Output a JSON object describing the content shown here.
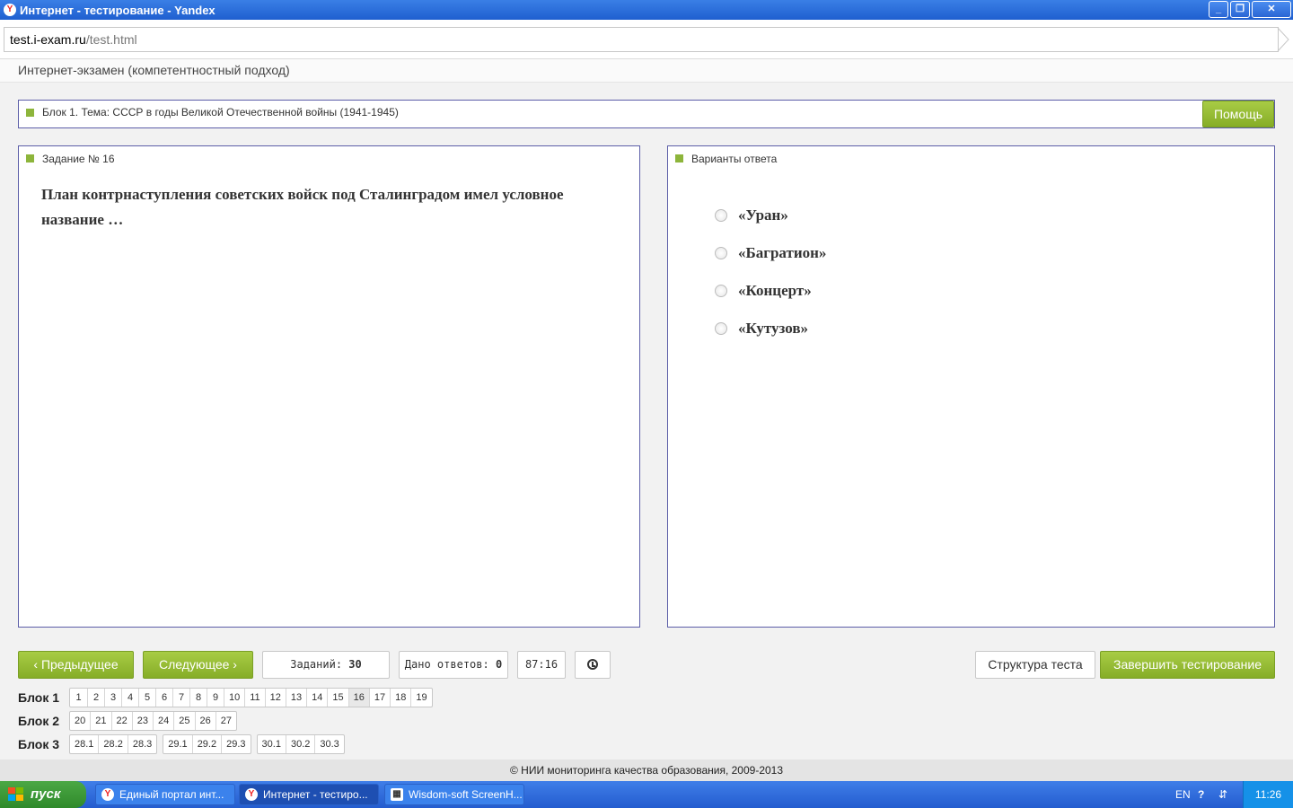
{
  "window": {
    "title": "Интернет - тестирование - Yandex"
  },
  "browser": {
    "url_host": "test.i-exam.ru",
    "url_path": "/test.html"
  },
  "page": {
    "header": "Интернет-экзамен (компетентностный подход)"
  },
  "topic": {
    "title": "Блок 1. Тема: СССР в годы Великой Отечественной войны (1941-1945)",
    "help_label": "Помощь"
  },
  "task": {
    "header": "Задание № 16",
    "question": "План контрнаступления советских войск под Сталинградом имел условное название …"
  },
  "answers": {
    "header": "Варианты ответа",
    "options": [
      "«Уран»",
      "«Багратион»",
      "«Концерт»",
      "«Кутузов»"
    ]
  },
  "controls": {
    "prev_label": "Предыдущее",
    "next_label": "Следующее",
    "tasks_label": "Заданий:",
    "tasks_count": "30",
    "answered_label": "Дано ответов:",
    "answered_count": "0",
    "timer": "87:16",
    "structure_label": "Структура теста",
    "finish_label": "Завершить тестирование"
  },
  "blocks": [
    {
      "label": "Блок 1",
      "groups": [
        [
          "1",
          "2",
          "3",
          "4",
          "5",
          "6",
          "7",
          "8",
          "9",
          "10",
          "11",
          "12",
          "13",
          "14",
          "15",
          "16",
          "17",
          "18",
          "19"
        ]
      ]
    },
    {
      "label": "Блок 2",
      "groups": [
        [
          "20",
          "21",
          "22",
          "23",
          "24",
          "25",
          "26",
          "27"
        ]
      ]
    },
    {
      "label": "Блок 3",
      "groups": [
        [
          "28.1",
          "28.2",
          "28.3"
        ],
        [
          "29.1",
          "29.2",
          "29.3"
        ],
        [
          "30.1",
          "30.2",
          "30.3"
        ]
      ]
    }
  ],
  "active_task": "16",
  "footer": "© НИИ мониторинга качества образования, 2009-2013",
  "taskbar": {
    "start_label": "пуск",
    "tasks": [
      "Единый портал инт...",
      "Интернет - тестиро...",
      "Wisdom-soft ScreenH..."
    ],
    "lang": "EN",
    "clock": "11:26"
  },
  "colors": {
    "accent_green": "#8db53b",
    "border_blue": "#5c5ea8",
    "taskbar_blue": "#245ccf"
  }
}
